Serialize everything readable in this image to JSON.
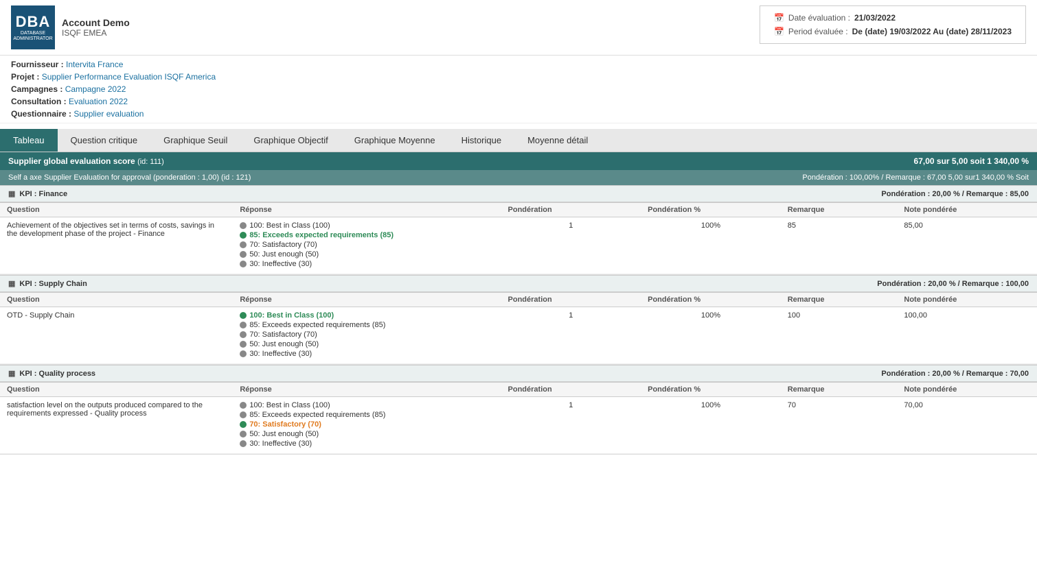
{
  "header": {
    "logo_letters": "DBA",
    "logo_sub": "DATABASE\nADMINISTRATOR",
    "account_name": "Account Demo",
    "account_sub": "ISQF EMEA"
  },
  "date_info": {
    "eval_label": "Date évaluation :",
    "eval_value": "21/03/2022",
    "period_label": "Period évaluée :",
    "period_value": "De (date) 19/03/2022 Au (date) 28/11/2023"
  },
  "meta": {
    "fournisseur_label": "Fournisseur :",
    "fournisseur_value": "Intervita France",
    "projet_label": "Projet :",
    "projet_value": "Supplier Performance Evaluation ISQF America",
    "campagnes_label": "Campagnes :",
    "campagnes_value": "Campagne 2022",
    "consultation_label": "Consultation :",
    "consultation_value": "Evaluation 2022",
    "questionnaire_label": "Questionnaire :",
    "questionnaire_value": "Supplier evaluation"
  },
  "tabs": [
    {
      "id": "tableau",
      "label": "Tableau",
      "active": true
    },
    {
      "id": "question_critique",
      "label": "Question critique",
      "active": false
    },
    {
      "id": "graphique_seuil",
      "label": "Graphique Seuil",
      "active": false
    },
    {
      "id": "graphique_objectif",
      "label": "Graphique Objectif",
      "active": false
    },
    {
      "id": "graphique_moyenne",
      "label": "Graphique Moyenne",
      "active": false
    },
    {
      "id": "historique",
      "label": "Historique",
      "active": false
    },
    {
      "id": "moyenne_detail",
      "label": "Moyenne détail",
      "active": false
    }
  ],
  "score_bar": {
    "title": "Supplier global evaluation score",
    "id_label": "(id: 111)",
    "score": "67,00 sur 5,00 soit 1 340,00 %"
  },
  "axe_bar": {
    "title": "Self a axe Supplier Evaluation for approval",
    "ponderation_label": "(ponderation : 1,00)",
    "id_label": "(id : 121)",
    "right_info": "Pondération : 100,00% / Remarque : 67,00 5,00 sur1 340,00 % Soit"
  },
  "kpi_sections": [
    {
      "id": "finance",
      "title": "KPI : Finance",
      "ponderation_info": "Pondération : 20,00 % / Remarque : 85,00",
      "columns": [
        "Question",
        "Réponse",
        "Pondération",
        "Pondération %",
        "Remarque",
        "Note pondérée"
      ],
      "rows": [
        {
          "question": "Achievement of the objectives set in terms of costs, savings in the development phase of the project - Finance",
          "options": [
            {
              "dot": "gray",
              "text": "100: Best in Class (100)",
              "selected": false
            },
            {
              "dot": "green",
              "text": "85: Exceeds expected requirements (85)",
              "selected": true,
              "color": "green"
            },
            {
              "dot": "gray",
              "text": "70: Satisfactory (70)",
              "selected": false
            },
            {
              "dot": "gray",
              "text": "50: Just enough (50)",
              "selected": false
            },
            {
              "dot": "gray",
              "text": "30: Ineffective (30)",
              "selected": false
            }
          ],
          "ponderation": "1",
          "ponderation_pct": "100%",
          "remarque": "85",
          "note_ponderee": "85,00"
        }
      ]
    },
    {
      "id": "supply_chain",
      "title": "KPI : Supply Chain",
      "ponderation_info": "Pondération : 20,00 % / Remarque : 100,00",
      "columns": [
        "Question",
        "Réponse",
        "Pondération",
        "Pondération %",
        "Remarque",
        "Note pondérée"
      ],
      "rows": [
        {
          "question": "OTD - Supply Chain",
          "options": [
            {
              "dot": "green",
              "text": "100: Best in Class (100)",
              "selected": true,
              "color": "green"
            },
            {
              "dot": "gray",
              "text": "85: Exceeds expected requirements (85)",
              "selected": false
            },
            {
              "dot": "gray",
              "text": "70: Satisfactory (70)",
              "selected": false
            },
            {
              "dot": "gray",
              "text": "50: Just enough (50)",
              "selected": false
            },
            {
              "dot": "gray",
              "text": "30: Ineffective (30)",
              "selected": false
            }
          ],
          "ponderation": "1",
          "ponderation_pct": "100%",
          "remarque": "100",
          "note_ponderee": "100,00"
        }
      ]
    },
    {
      "id": "quality_process",
      "title": "KPI : Quality process",
      "ponderation_info": "Pondération : 20,00 % / Remarque : 70,00",
      "columns": [
        "Question",
        "Réponse",
        "Pondération",
        "Pondération %",
        "Remarque",
        "Note pondérée"
      ],
      "rows": [
        {
          "question": "satisfaction level on the outputs produced compared to the requirements expressed - Quality process",
          "options": [
            {
              "dot": "gray",
              "text": "100: Best in Class (100)",
              "selected": false
            },
            {
              "dot": "gray",
              "text": "85: Exceeds expected requirements (85)",
              "selected": false
            },
            {
              "dot": "green",
              "text": "70: Satisfactory (70)",
              "selected": true,
              "color": "orange"
            },
            {
              "dot": "gray",
              "text": "50: Just enough (50)",
              "selected": false
            },
            {
              "dot": "gray",
              "text": "30: Ineffective (30)",
              "selected": false
            }
          ],
          "ponderation": "1",
          "ponderation_pct": "100%",
          "remarque": "70",
          "note_ponderee": "70,00"
        }
      ]
    }
  ]
}
